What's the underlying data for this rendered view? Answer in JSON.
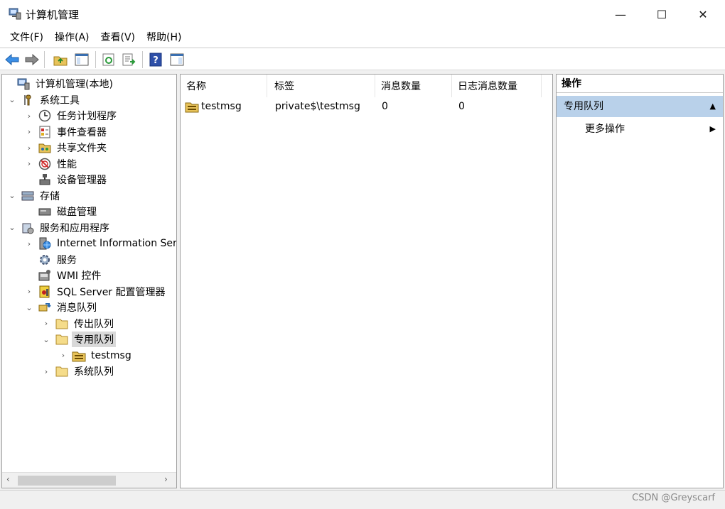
{
  "window": {
    "title": "计算机管理",
    "controls": {
      "minimize": "—",
      "maximize": "☐",
      "close": "✕"
    }
  },
  "menu": [
    {
      "label": "文件(F)"
    },
    {
      "label": "操作(A)"
    },
    {
      "label": "查看(V)"
    },
    {
      "label": "帮助(H)"
    }
  ],
  "toolbar": {
    "buttons": [
      "back-icon",
      "forward-icon",
      "up-folder-icon",
      "show-hide-tree-icon",
      "refresh-icon",
      "export-list-icon",
      "help-icon",
      "show-hide-action-pane-icon"
    ]
  },
  "tree": [
    {
      "label": "计算机管理(本地)",
      "icon": "computer-management-icon",
      "expander": ""
    },
    {
      "label": "系统工具",
      "icon": "tools-icon",
      "expander": "⌄"
    },
    {
      "label": "任务计划程序",
      "icon": "clock-icon",
      "expander": "›"
    },
    {
      "label": "事件查看器",
      "icon": "event-viewer-icon",
      "expander": "›"
    },
    {
      "label": "共享文件夹",
      "icon": "shared-folder-icon",
      "expander": "›"
    },
    {
      "label": "性能",
      "icon": "performance-icon",
      "expander": "›"
    },
    {
      "label": "设备管理器",
      "icon": "device-manager-icon",
      "expander": ""
    },
    {
      "label": "存储",
      "icon": "storage-icon",
      "expander": "⌄"
    },
    {
      "label": "磁盘管理",
      "icon": "disk-icon",
      "expander": ""
    },
    {
      "label": "服务和应用程序",
      "icon": "services-apps-icon",
      "expander": "⌄"
    },
    {
      "label": "Internet Information Services",
      "icon": "iis-icon",
      "expander": "›"
    },
    {
      "label": "服务",
      "icon": "gear-icon",
      "expander": ""
    },
    {
      "label": "WMI 控件",
      "icon": "wmi-icon",
      "expander": ""
    },
    {
      "label": "SQL Server 配置管理器",
      "icon": "sql-config-icon",
      "expander": "›"
    },
    {
      "label": "消息队列",
      "icon": "message-queue-icon",
      "expander": "⌄"
    },
    {
      "label": "传出队列",
      "icon": "folder-icon",
      "expander": "›"
    },
    {
      "label": "专用队列",
      "icon": "folder-icon",
      "expander": "⌄"
    },
    {
      "label": "testmsg",
      "icon": "queue-icon",
      "expander": "›"
    },
    {
      "label": "系统队列",
      "icon": "folder-icon",
      "expander": "›"
    }
  ],
  "list": {
    "columns": [
      "名称",
      "标签",
      "消息数量",
      "日志消息数量"
    ],
    "rows": [
      {
        "name": "testmsg",
        "label": "private$\\testmsg",
        "count": "0",
        "journal_count": "0"
      }
    ]
  },
  "actions": {
    "header": "操作",
    "group": "专用队列",
    "items": [
      {
        "label": "更多操作"
      }
    ]
  },
  "scrollbar": {
    "left_arrow": "‹",
    "right_arrow": "›"
  },
  "watermark": "CSDN @Greyscarf",
  "colors": {
    "selected_group": "#b9d1ea",
    "selected_row": "#d9d9d9"
  }
}
